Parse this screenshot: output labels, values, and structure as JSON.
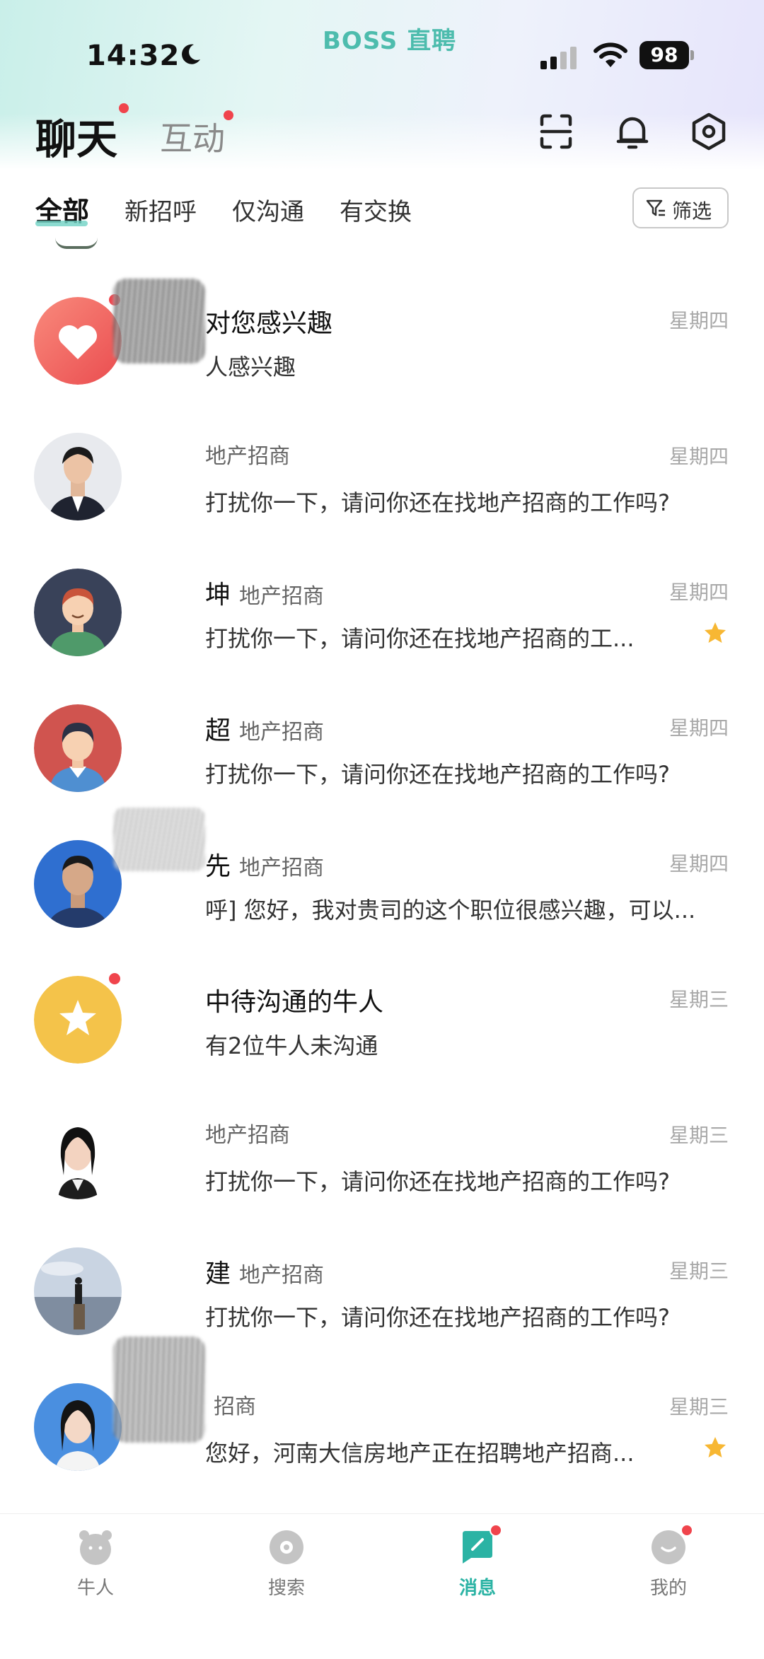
{
  "status_bar": {
    "time": "14:32",
    "app_brand": "BOSS 直聘",
    "battery": "98"
  },
  "header": {
    "tab_chat": "聊天",
    "tab_interact": "互动"
  },
  "filters": {
    "tabs": [
      "全部",
      "新招呼",
      "仅沟通",
      "有交换"
    ],
    "filter_button": "筛选"
  },
  "conversations": [
    {
      "name": "对您感兴趣",
      "job": "",
      "message": "人感兴趣",
      "time": "星期四",
      "starred": false,
      "unread": true
    },
    {
      "name": "",
      "job": "地产招商",
      "message": "打扰你一下，请问你还在找地产招商的工作吗?",
      "time": "星期四",
      "starred": false,
      "unread": false
    },
    {
      "name": "坤",
      "job": "地产招商",
      "message": "打扰你一下，请问你还在找地产招商的工...",
      "time": "星期四",
      "starred": true,
      "unread": false
    },
    {
      "name": "超",
      "job": "地产招商",
      "message": "打扰你一下，请问你还在找地产招商的工作吗?",
      "time": "星期四",
      "starred": false,
      "unread": false
    },
    {
      "name": "先",
      "job": "地产招商",
      "message": "呼] 您好，我对贵司的这个职位很感兴趣，可以...",
      "time": "星期四",
      "starred": false,
      "unread": false
    },
    {
      "name": "中待沟通的牛人",
      "job": "",
      "message": "有2位牛人未沟通",
      "time": "星期三",
      "starred": false,
      "unread": true
    },
    {
      "name": "",
      "job": "地产招商",
      "message": "打扰你一下，请问你还在找地产招商的工作吗?",
      "time": "星期三",
      "starred": false,
      "unread": false
    },
    {
      "name": "建",
      "job": "地产招商",
      "message": "打扰你一下，请问你还在找地产招商的工作吗?",
      "time": "星期三",
      "starred": false,
      "unread": false
    },
    {
      "name": "",
      "job": "招商",
      "message": "您好，河南大信房地产正在招聘地产招商...",
      "time": "星期三",
      "starred": true,
      "unread": false
    }
  ],
  "tabbar": {
    "items": [
      "牛人",
      "搜索",
      "消息",
      "我的"
    ],
    "active": "消息"
  },
  "colors": {
    "accent": "#2bb3a4",
    "badge": "#f0444c",
    "star": "#f7b733"
  }
}
